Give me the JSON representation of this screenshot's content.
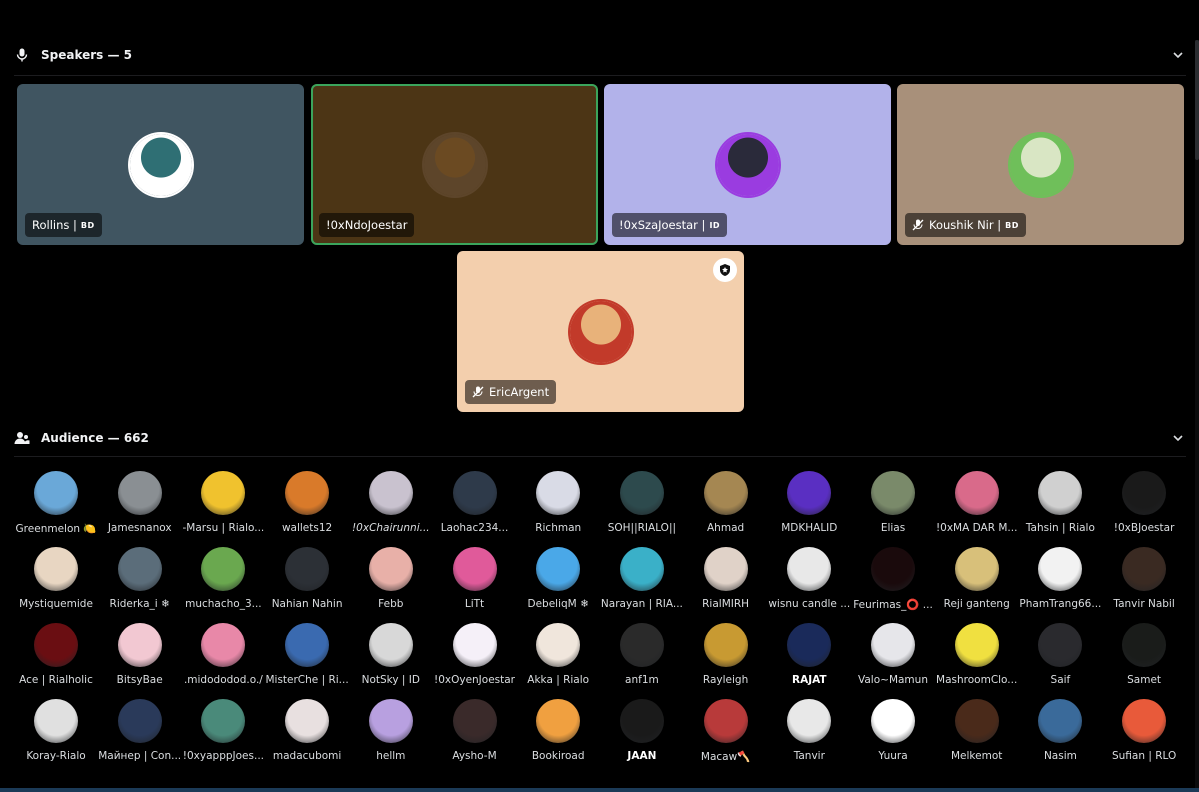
{
  "speakers": {
    "title": "Speakers — 5",
    "tiles": [
      {
        "name": "Rollins |",
        "tag": "BD",
        "muted": false,
        "bg": "#405561",
        "ring": "#ffffff",
        "avatar": "#2f6f74",
        "highlight": false
      },
      {
        "name": "!0xNdoJoestar",
        "tag": "",
        "muted": false,
        "bg": "#4c3515",
        "ring": "#5d452a",
        "avatar": "#6b4a22",
        "highlight": true
      },
      {
        "name": "!0xSzaJoestar |",
        "tag": "ID",
        "muted": false,
        "bg": "#b2b2ea",
        "ring": "#9a3ce0",
        "avatar": "#2a2a3a",
        "highlight": false
      },
      {
        "name": "Koushik Nir |",
        "tag": "BD",
        "muted": true,
        "bg": "#a8907a",
        "ring": "#6fbf5a",
        "avatar": "#d9e6c4",
        "highlight": false
      },
      {
        "name": "EricArgent",
        "tag": "",
        "muted": true,
        "bg": "#f3cfad",
        "ring": "#c23a2a",
        "avatar": "#e8b27a",
        "highlight": false,
        "badge": "star-badge-icon"
      }
    ]
  },
  "audience": {
    "title": "Audience — 662",
    "members": [
      {
        "name": "Greenmelon 🍋",
        "color": "#6aa8d8"
      },
      {
        "name": "Jamesnanox",
        "color": "#8a8f93"
      },
      {
        "name": "-Marsu | Rialo...",
        "color": "#f0c22e"
      },
      {
        "name": "wallets12",
        "color": "#d97a2a"
      },
      {
        "name": "!0xChairunni...",
        "color": "#c9c2cf",
        "style": "italic"
      },
      {
        "name": "Laohac234...",
        "color": "#2e3a4a"
      },
      {
        "name": "Richman",
        "color": "#d9dbe6"
      },
      {
        "name": "SOH||RIALO||",
        "color": "#2d4a4d"
      },
      {
        "name": "Ahmad",
        "color": "#a58752"
      },
      {
        "name": "MDKHALID",
        "color": "#5a2fc2"
      },
      {
        "name": "Elias",
        "color": "#7a8a6a"
      },
      {
        "name": "!0xMA DAR M...",
        "color": "#d96a8a"
      },
      {
        "name": "Tahsin | Rialo",
        "color": "#d0d0d0"
      },
      {
        "name": "!0xBJoestar",
        "color": "#1a1a1a"
      },
      {
        "name": "Mystiquemide",
        "color": "#e8d6c2"
      },
      {
        "name": "Riderka_i ❄",
        "color": "#5b6d7a"
      },
      {
        "name": "muchacho_3...",
        "color": "#6aa84f"
      },
      {
        "name": "Nahian Nahin",
        "color": "#2c3036"
      },
      {
        "name": "Febb",
        "color": "#e8b0a8"
      },
      {
        "name": "LiTt",
        "color": "#e05a9a"
      },
      {
        "name": "DebeliqM ❄",
        "color": "#4aa8e8"
      },
      {
        "name": "Narayan | RIA...",
        "color": "#3ab0c8"
      },
      {
        "name": "RialMIRH",
        "color": "#e0d2c8"
      },
      {
        "name": "wisnu candle ...",
        "color": "#e8e8e8"
      },
      {
        "name": "Feurimas_⭕ ...",
        "color": "#1a0a0c"
      },
      {
        "name": "Reji ganteng",
        "color": "#d8c07a"
      },
      {
        "name": "PhamTrang66...",
        "color": "#f2f2f2"
      },
      {
        "name": "Tanvir Nabil",
        "color": "#3a2a22"
      },
      {
        "name": "Ace | Rialholic",
        "color": "#6a0e12"
      },
      {
        "name": "BitsyBae",
        "color": "#f2c8d2"
      },
      {
        "name": ".midododod.o./",
        "color": "#e888a8"
      },
      {
        "name": "MisterChe | Ri...",
        "color": "#3a6ab0"
      },
      {
        "name": "NotSky | ID",
        "color": "#d8d8d8"
      },
      {
        "name": "!0xOyenJoestar",
        "color": "#f5f0f8"
      },
      {
        "name": "Akka | Rialo",
        "color": "#f0e6dc"
      },
      {
        "name": "anf1m",
        "color": "#2a2a2a"
      },
      {
        "name": "Rayleigh",
        "color": "#c89a32"
      },
      {
        "name": "RAJAT",
        "color": "#1a2a5a",
        "style": "bold"
      },
      {
        "name": "Valo~Mamun",
        "color": "#e6e6ea"
      },
      {
        "name": "MashroomClo...",
        "color": "#f0e040"
      },
      {
        "name": "Saif",
        "color": "#2a2a2e"
      },
      {
        "name": "Samet",
        "color": "#1a1c1a"
      },
      {
        "name": "Koray-Rialo",
        "color": "#e0e0e0"
      },
      {
        "name": "Майнер | Con...",
        "color": "#2a3a5a"
      },
      {
        "name": "!0xyapppJoes...",
        "color": "#4a8a7a"
      },
      {
        "name": "madacubomi",
        "color": "#e8e0e0"
      },
      {
        "name": "hellm",
        "color": "#b8a0e0"
      },
      {
        "name": "Aysho-M",
        "color": "#3a2a2a"
      },
      {
        "name": "Bookiroad",
        "color": "#f0a040"
      },
      {
        "name": "JAAN",
        "color": "#1a1a1a",
        "style": "bold"
      },
      {
        "name": "Macaw🪓",
        "color": "#b83a3a"
      },
      {
        "name": "Tanvir",
        "color": "#e8e8e8"
      },
      {
        "name": "Yuura",
        "color": "#ffffff"
      },
      {
        "name": "Melkemot",
        "color": "#4a2a1a"
      },
      {
        "name": "Nasim",
        "color": "#3a6a9a"
      },
      {
        "name": "Sufian | RLO",
        "color": "#e85a3a"
      }
    ],
    "partial_row_colors": [
      "#3a2a4a",
      "#f0f0f0",
      "#2a2a2a",
      "#f0c020",
      "#1a1a1a",
      "#e8e0c8",
      "#2a2a2a",
      "#e8c8a8",
      "#6a3a2a",
      "#1a1a1a",
      "#8a8a8a",
      "#2a5a8a",
      "#3aa0e0",
      "#f0f0f0",
      "#5a2a8a"
    ]
  }
}
